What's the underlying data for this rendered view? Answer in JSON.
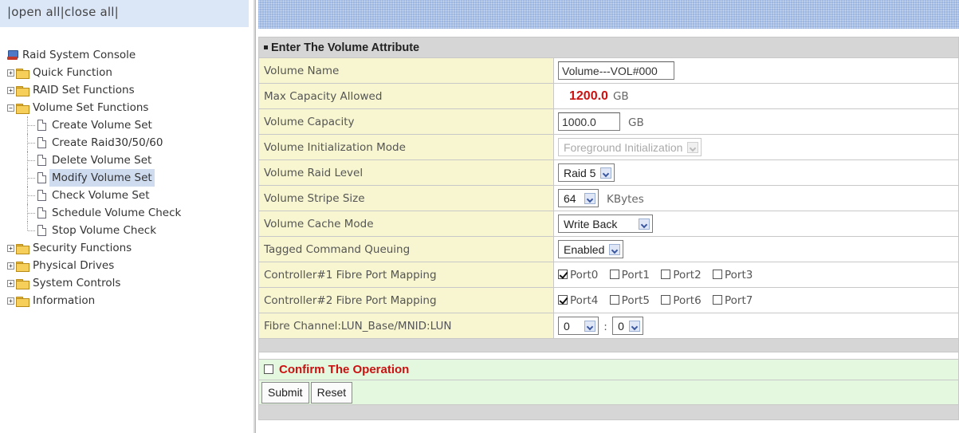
{
  "nav": {
    "open_all": "open all",
    "close_all": "close all",
    "tree": {
      "root": "Raid System Console",
      "items": [
        {
          "label": "Quick Function"
        },
        {
          "label": "RAID Set Functions"
        },
        {
          "label": "Volume Set Functions",
          "children": [
            "Create Volume Set",
            "Create Raid30/50/60",
            "Delete Volume Set",
            "Modify Volume Set",
            "Check Volume Set",
            "Schedule Volume Check",
            "Stop Volume Check"
          ]
        },
        {
          "label": "Security Functions"
        },
        {
          "label": "Physical Drives"
        },
        {
          "label": "System Controls"
        },
        {
          "label": "Information"
        }
      ],
      "selected": "Modify Volume Set"
    }
  },
  "form": {
    "header": "Enter The Volume Attribute",
    "rows": {
      "volume_name": {
        "label": "Volume Name",
        "value": "Volume---VOL#000"
      },
      "max_capacity": {
        "label": "Max Capacity Allowed",
        "value": "1200.0",
        "unit": "GB"
      },
      "volume_capacity": {
        "label": "Volume Capacity",
        "value": "1000.0",
        "unit": "GB"
      },
      "init_mode": {
        "label": "Volume Initialization Mode",
        "value": "Foreground Initialization"
      },
      "raid_level": {
        "label": "Volume Raid Level",
        "value": "Raid 5"
      },
      "stripe_size": {
        "label": "Volume Stripe Size",
        "value": "64",
        "unit": "KBytes"
      },
      "cache_mode": {
        "label": "Volume Cache Mode",
        "value": "Write Back"
      },
      "tcq": {
        "label": "Tagged Command Queuing",
        "value": "Enabled"
      },
      "ctrl1": {
        "label": "Controller#1 Fibre Port Mapping",
        "ports": [
          "Port0",
          "Port1",
          "Port2",
          "Port3"
        ]
      },
      "ctrl2": {
        "label": "Controller#2 Fibre Port Mapping",
        "ports": [
          "Port4",
          "Port5",
          "Port6",
          "Port7"
        ]
      },
      "lun": {
        "label": "Fibre Channel:LUN_Base/MNID:LUN",
        "base": "0",
        "separator": ":",
        "lun": "0"
      }
    },
    "confirm_label": "Confirm The Operation",
    "submit_label": "Submit",
    "reset_label": "Reset"
  }
}
